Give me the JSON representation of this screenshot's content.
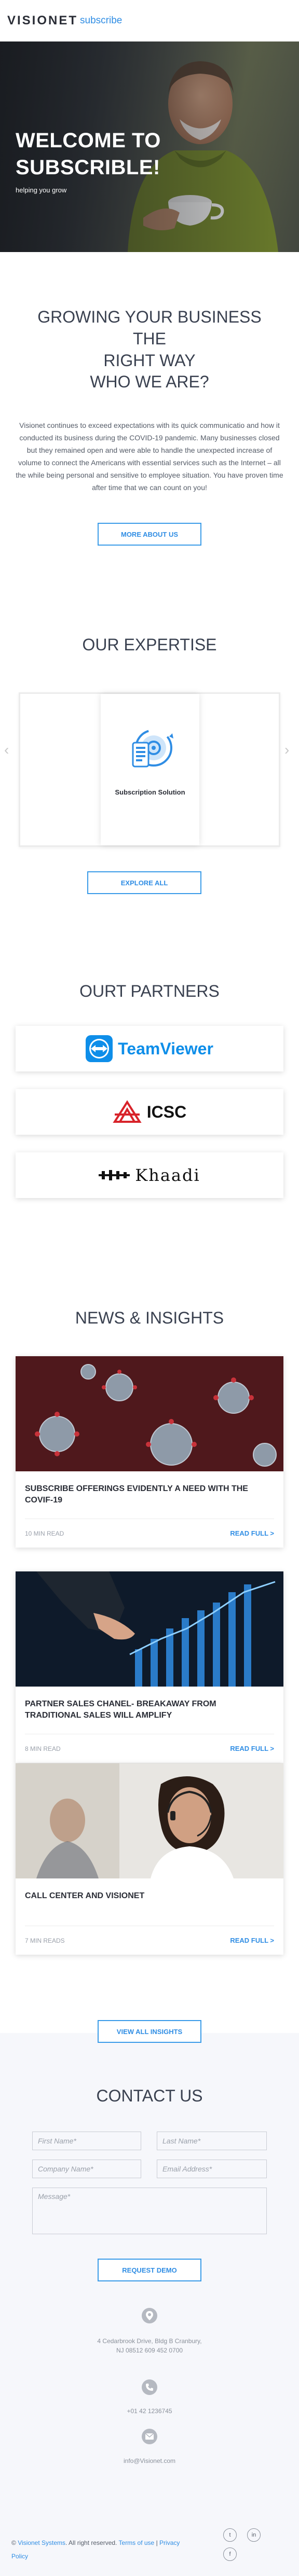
{
  "header": {
    "logo": "VISIONET",
    "logo_sub": "subscribe"
  },
  "hero": {
    "title_line1": "WELCOME TO",
    "title_line2": "SUBSCRIBLE!",
    "tagline": "helping you grow"
  },
  "growing": {
    "title_line1": "GROWING YOUR BUSINESS THE",
    "title_line2": "RIGHT WAY"
  },
  "who": {
    "title": "WHO WE ARE?",
    "text": "Visionet continues to exceed expectations with its quick communicatio and how it conducted its business during the COVID-19 pandemic. Many businesses closed but they remained open and were able to handle the unexpected increase of volume to connect the Americans with essential services such as the Internet – all the while being personal and sensitive to employee situation. You have proven time after time that we can count on you!",
    "button": "MORE ABOUT US"
  },
  "expertise": {
    "title": "OUR EXPERTISE",
    "card_label": "Subscription Solution",
    "arrow_left": "‹",
    "arrow_right": "›",
    "button": "EXPLORE ALL"
  },
  "partners": {
    "title": "OURT PARTNERS",
    "items": [
      {
        "name": "TeamViewer"
      },
      {
        "name": "ICSC"
      },
      {
        "name": "Khaadi"
      }
    ]
  },
  "news": {
    "title": "NEWS & INSIGHTS",
    "items": [
      {
        "title": "SUBSCRIBE OFFERINGS EVIDENTLY A NEED WITH THE COVIF-19",
        "time": "10 MIN READ",
        "read": "READ FULL >"
      },
      {
        "title": "PARTNER SALES CHANEL- BREAKAWAY FROM TRADITIONAL SALES WILL AMPLIFY",
        "time": "8 MIN READ",
        "read": "READ FULL >"
      },
      {
        "title": "CALL CENTER AND VISIONET",
        "time": "7 MIN READS",
        "read": "READ FULL >"
      }
    ],
    "button": "VIEW ALL INSIGHTS"
  },
  "contact": {
    "title": "CONTACT US",
    "first_name": "First Name*",
    "last_name": "Last Name*",
    "company": "Company Name*",
    "email": "Email Address*",
    "message": "Message*",
    "button": "REQUEST DEMO",
    "address_line1": "4 Cedarbrook Drive, Bldg B Cranbury,",
    "address_line2": "NJ 08512 609 452 0700",
    "phone": "+01 42 1236745",
    "mail": "info@Visionet.com"
  },
  "footer": {
    "copyright_prefix": "©",
    "company_link": "Visionet Systems",
    "rights": ". All right reserved.",
    "terms": "Terms of use",
    "sep": "|",
    "privacy_line1": "Privacy",
    "privacy_line2": "Policy"
  },
  "social": {
    "twitter": "t",
    "linkedin": "in",
    "facebook": "f"
  },
  "colors": {
    "accent": "#2f8de4",
    "teamviewer": "#0e8ee9",
    "icsc_red": "#d8232a"
  }
}
